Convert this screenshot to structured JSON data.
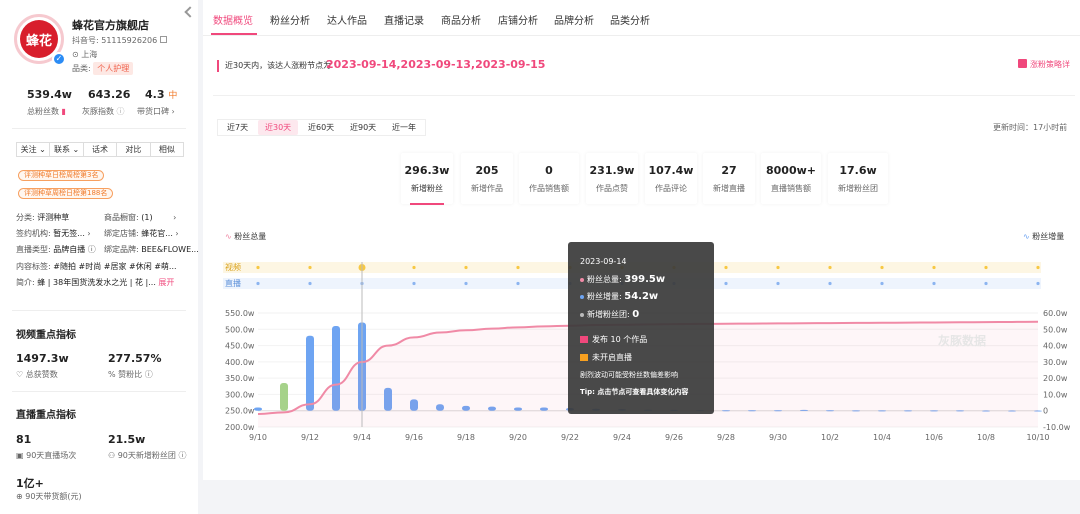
{
  "shop": {
    "name": "蜂花官方旗舰店",
    "logo_text": "蜂花",
    "account": "抖音号: 51115926206",
    "location": "上海",
    "category_label": "品类:",
    "category_value": "个人护理"
  },
  "stats": [
    {
      "value": "539.4w",
      "label": "总粉丝数"
    },
    {
      "value": "643.26",
      "label": "灰豚指数"
    },
    {
      "value": "4.3",
      "badge": "中",
      "label": "带货口碑"
    }
  ],
  "action_buttons": [
    "关注",
    "联系",
    "话术",
    "对比",
    "相似"
  ],
  "rank_tags": [
    "评测种草日榜周榜第3名",
    "评测种草周榜日榜第188名"
  ],
  "info": {
    "type_label": "分类:",
    "type_value": "评测种草",
    "window_label": "商品橱窗:",
    "window_value": "(1)",
    "org_label": "签约机构:",
    "org_value": "暂无签...",
    "bind_label": "绑定店铺:",
    "bind_value": "蜂花官...",
    "live_label": "直播类型:",
    "live_value": "品牌自播",
    "brand_label": "绑定品牌:",
    "brand_value": "BEE&FLOWE...",
    "tags_label": "内容标签:",
    "tags_value": "#随拍 #时尚 #居家 #休闲 #萌...",
    "intro_label": "简介:",
    "intro_value": "蜂 | 38年国货洗发水之光 | 花 |...",
    "expand": "展开"
  },
  "video_section": {
    "title": "视频重点指标",
    "m1_value": "1497.3w",
    "m1_label": "总获赞数",
    "m2_value": "277.57%",
    "m2_label": "赞粉比"
  },
  "live_section": {
    "title": "直播重点指标",
    "m1_value": "81",
    "m1_label": "90天直播场次",
    "m2_value": "21.5w",
    "m2_label": "90天新增粉丝团",
    "m3_value": "1亿+",
    "m3_label": "90天带货额(元)"
  },
  "tabs": [
    "数据概览",
    "粉丝分析",
    "达人作品",
    "直播记录",
    "商品分析",
    "店铺分析",
    "品牌分析",
    "品类分析"
  ],
  "active_tab": "数据概览",
  "notice": {
    "text": "近30天内，该达人涨粉节点为",
    "dates": "2023-09-14,2023-09-13,2023-09-15",
    "button": "涨粉策略详"
  },
  "periods": [
    "近7天",
    "近30天",
    "近60天",
    "近90天",
    "近一年"
  ],
  "active_period": "近30天",
  "update_time": "更新时间：17小时前",
  "metrics": [
    {
      "value": "296.3w",
      "label": "新增粉丝"
    },
    {
      "value": "205",
      "label": "新增作品"
    },
    {
      "value": "0",
      "label": "作品销售额"
    },
    {
      "value": "231.9w",
      "label": "作品点赞"
    },
    {
      "value": "107.4w",
      "label": "作品评论"
    },
    {
      "value": "27",
      "label": "新增直播"
    },
    {
      "value": "8000w+",
      "label": "直播销售额"
    },
    {
      "value": "17.6w",
      "label": "新增粉丝团"
    }
  ],
  "colors": {
    "accent": "#f0487c",
    "bar_blue": "#6ea4f2",
    "bar_green": "#a6d28a",
    "line_pink": "#f08aa6",
    "video_yellow": "#f7c843",
    "live_blue": "#8cb4f0"
  },
  "chart_data": {
    "type": "bar",
    "legend_left": "粉丝总量",
    "legend_right": "粉丝增量",
    "track_video": "视频",
    "track_live": "直播",
    "x": [
      "9/10",
      "9/11",
      "9/12",
      "9/13",
      "9/14",
      "9/15",
      "9/16",
      "9/17",
      "9/18",
      "9/19",
      "9/20",
      "9/21",
      "9/22",
      "9/23",
      "9/24",
      "9/25",
      "9/26",
      "9/27",
      "9/28",
      "9/29",
      "9/30",
      "10/1",
      "10/2",
      "10/3",
      "10/4",
      "10/5",
      "10/6",
      "10/7",
      "10/8",
      "10/9",
      "10/10"
    ],
    "x_tick_labels": [
      "9/10",
      "9/12",
      "9/14",
      "9/16",
      "9/18",
      "9/20",
      "9/22",
      "9/24",
      "9/26",
      "9/28",
      "9/30",
      "10/2",
      "10/4",
      "10/6",
      "10/8",
      "10/10"
    ],
    "left_axis": {
      "ticks": [
        "200.0w",
        "250.0w",
        "300.0w",
        "350.0w",
        "400.0w",
        "450.0w",
        "500.0w",
        "550.0w"
      ],
      "range": [
        200,
        550
      ]
    },
    "right_axis": {
      "ticks": [
        "-10.0w",
        "0",
        "10.0w",
        "20.0w",
        "30.0w",
        "40.0w",
        "50.0w",
        "60.0w"
      ],
      "range": [
        -10,
        60
      ]
    },
    "fans_total_w": [
      240,
      245,
      270,
      330,
      399.5,
      450,
      475,
      490,
      497,
      502,
      506,
      509,
      511,
      513,
      514,
      515,
      516,
      516.5,
      517,
      517.5,
      518,
      518.5,
      519,
      519.5,
      520,
      520.5,
      521,
      521.5,
      522,
      522.5,
      523
    ],
    "fans_increase_w": [
      2,
      17,
      46,
      52,
      54.2,
      14,
      7,
      4,
      3,
      2.5,
      2,
      2,
      1.7,
      1.2,
      1,
      0.6,
      0.5,
      0.4,
      0.3,
      0.3,
      0.3,
      0.5,
      0.3,
      0.2,
      0.2,
      0.2,
      0.2,
      0.2,
      0.1,
      0.1,
      0.1
    ],
    "highlight_index_green": 1
  },
  "tooltip": {
    "date": "2023-09-14",
    "total_label": "粉丝总量:",
    "total_value": "399.5w",
    "inc_label": "粉丝增量:",
    "inc_value": "54.2w",
    "club_label": "新增粉丝团:",
    "club_value": "0",
    "works": "发布 10 个作品",
    "live": "未开启直播",
    "hint": "剧烈波动可能受粉丝数偏差影响",
    "tip": "Tip: 点击节点可查看具体变化内容"
  },
  "watermark": "灰豚数据"
}
